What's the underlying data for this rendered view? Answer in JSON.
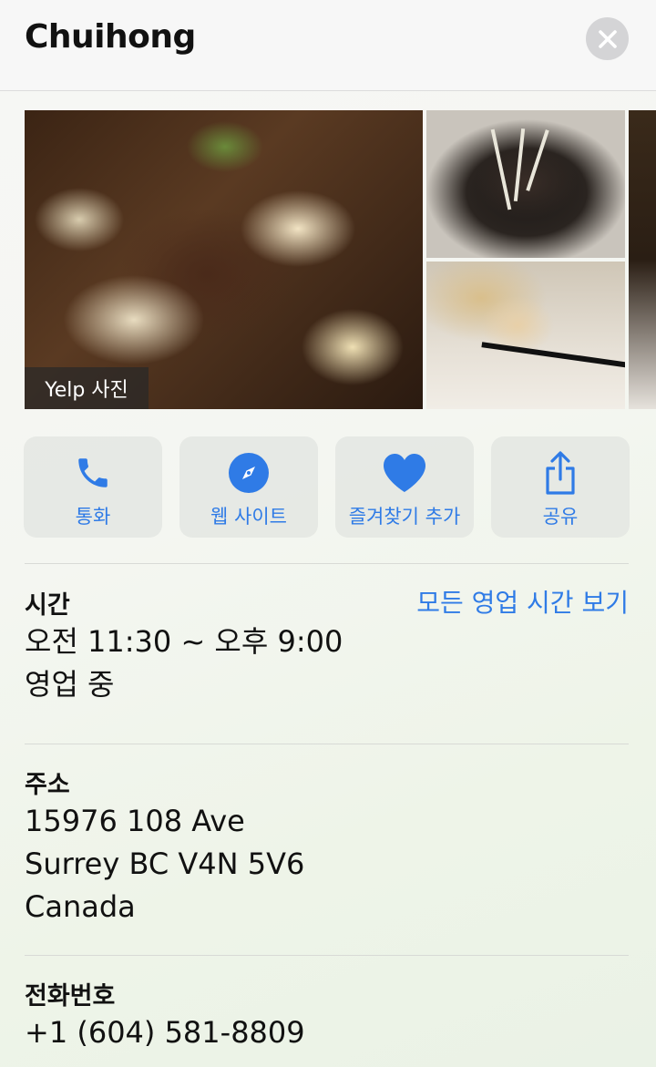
{
  "header": {
    "title": "Chuihong",
    "close_icon": "close-icon"
  },
  "photos": {
    "badge": "Yelp 사진"
  },
  "actions": [
    {
      "label": "통화",
      "icon": "phone-icon"
    },
    {
      "label": "웹 사이트",
      "icon": "compass-icon"
    },
    {
      "label": "즐겨찾기 추가",
      "icon": "heart-icon"
    },
    {
      "label": "공유",
      "icon": "share-icon"
    }
  ],
  "hours": {
    "label": "시간",
    "link": "모든 영업 시간 보기",
    "time": "오전 11:30 ~ 오후 9:00",
    "status": "영업 중"
  },
  "address": {
    "label": "주소",
    "lines": [
      "15976 108 Ave",
      "Surrey BC V4N 5V6",
      "Canada"
    ]
  },
  "phone": {
    "label": "전화번호",
    "number": "+1 (604) 581-8809"
  },
  "colors": {
    "accent": "#2f7be6",
    "button_bg": "#e2e4e0",
    "close_bg": "#d4d4d6"
  }
}
